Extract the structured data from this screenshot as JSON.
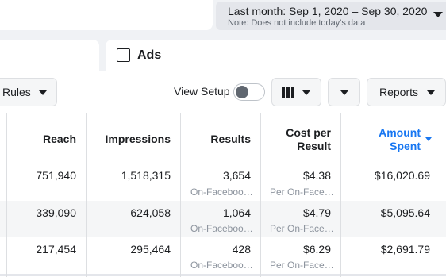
{
  "date_range": {
    "label": "Last month: Sep 1, 2020 – Sep 30, 2020",
    "note": "Note: Does not include today's data"
  },
  "level_tab": {
    "label": "Ads"
  },
  "toolbar": {
    "rules_label": "Rules",
    "view_setup_label": "View Setup",
    "view_setup_enabled": false,
    "reports_label": "Reports"
  },
  "table": {
    "columns": {
      "reach": "Reach",
      "impressions": "Impressions",
      "results": "Results",
      "cost_per_result_line1": "Cost per",
      "cost_per_result_line2": "Result",
      "amount_spent_line1": "Amount",
      "amount_spent_line2": "Spent"
    },
    "sorted_column": "amount_spent",
    "rows": [
      {
        "reach": "751,940",
        "impressions": "1,518,315",
        "results": "3,654",
        "results_sub": "On-Faceboo…",
        "cost": "$4.38",
        "cost_sub": "Per On-Face…",
        "spent": "$16,020.69"
      },
      {
        "reach": "339,090",
        "impressions": "624,058",
        "results": "1,064",
        "results_sub": "On-Faceboo…",
        "cost": "$4.79",
        "cost_sub": "Per On-Face…",
        "spent": "$5,095.64"
      },
      {
        "reach": "217,454",
        "impressions": "295,464",
        "results": "428",
        "results_sub": "On-Faceboo…",
        "cost": "$6.29",
        "cost_sub": "Per On-Face…",
        "spent": "$2,691.79"
      }
    ]
  },
  "colors": {
    "accent": "#1877f2",
    "background": "#f0f2f5",
    "panel": "#ffffff"
  },
  "icons": [
    "chevron-down-icon",
    "ads-icon",
    "columns-icon"
  ]
}
